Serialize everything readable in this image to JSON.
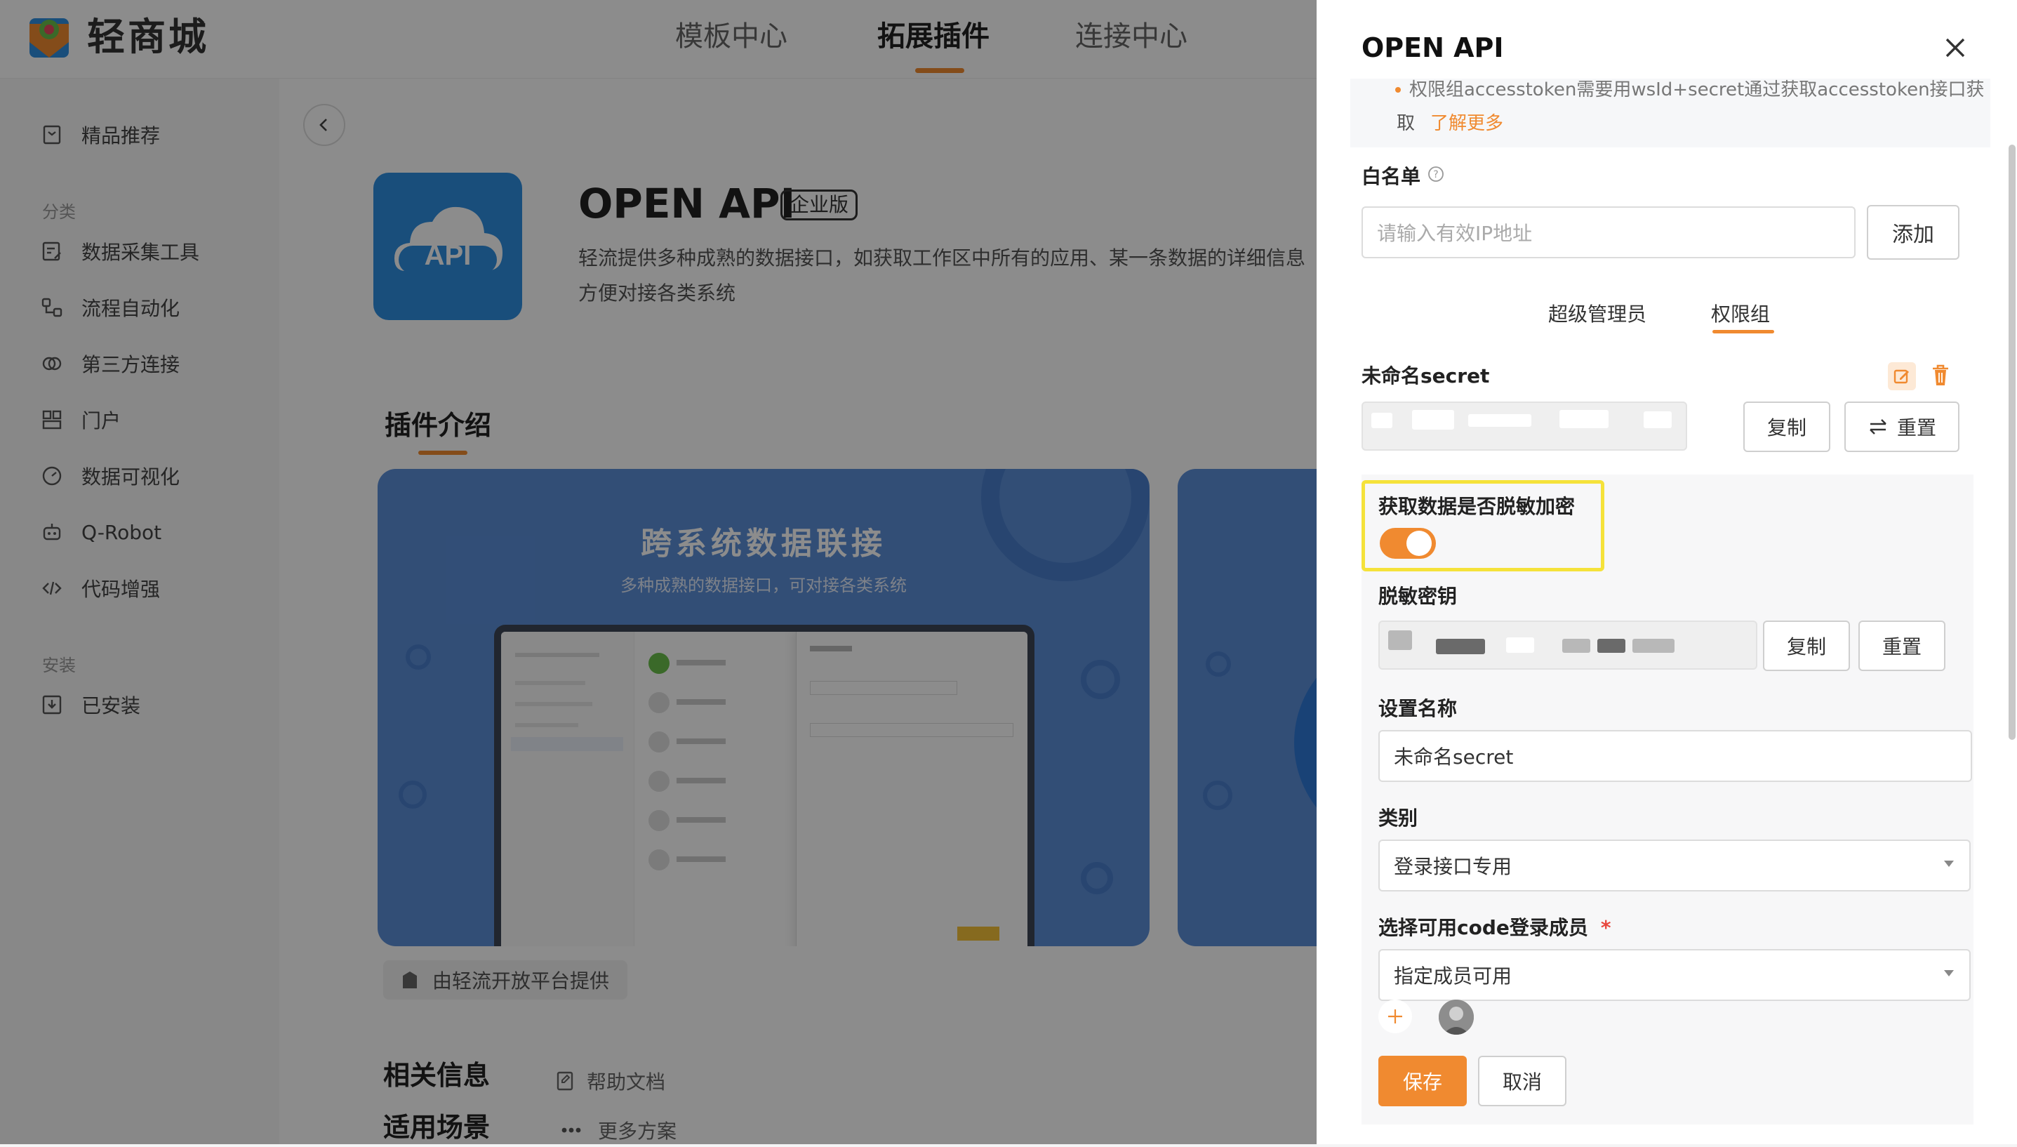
{
  "app": {
    "brand": "轻商城",
    "nav_tabs": [
      {
        "label": "模板中心",
        "active": false
      },
      {
        "label": "拓展插件",
        "active": true
      },
      {
        "label": "连接中心",
        "active": false
      }
    ],
    "accent_color": "#f08a30"
  },
  "sidebar": {
    "featured": "精品推荐",
    "category_heading": "分类",
    "items": [
      "数据采集工具",
      "流程自动化",
      "第三方连接",
      "门户",
      "数据可视化",
      "Q-Robot",
      "代码增强"
    ],
    "install_heading": "安装",
    "installed": "已安装"
  },
  "plugin": {
    "name": "OPEN API",
    "badge": "企业版",
    "logo_text": "API",
    "description_line1": "轻流提供多种成熟的数据接口，如获取工作区中所有的应用、某一条数据的详细信息",
    "description_line2": "方便对接各类系统",
    "intro_heading": "插件介绍",
    "banner_title": "跨系统数据联接",
    "banner_subtitle": "多种成熟的数据接口，可对接各类系统",
    "provider": "由轻流开放平台提供",
    "related_heading": "相关信息",
    "help_doc": "帮助文档",
    "scenario_heading": "适用场景",
    "more_plans": "更多方案"
  },
  "drawer": {
    "title": "OPEN API",
    "notice_line1": "权限组accesstoken需要用wsId+secret通过获取accesstoken接口获",
    "notice_line2": "取",
    "notice_link": "了解更多",
    "whitelist_label": "白名单",
    "ip_placeholder": "请输入有效IP地址",
    "add_button": "添加",
    "tabs": [
      {
        "label": "超级管理员",
        "active": false
      },
      {
        "label": "权限组",
        "active": true
      }
    ],
    "secret_name": "未命名secret",
    "copy_button": "复制",
    "reset_button": "重置",
    "desensitize_label": "获取数据是否脱敏加密",
    "desensitize_enabled": true,
    "desensitize_key_label": "脱敏密钥",
    "set_name_label": "设置名称",
    "set_name_value": "未命名secret",
    "category_label": "类别",
    "category_value": "登录接口专用",
    "members_label": "选择可用code登录成员",
    "members_required_mark": "*",
    "members_value": "指定成员可用",
    "save_button": "保存",
    "cancel_button": "取消"
  }
}
